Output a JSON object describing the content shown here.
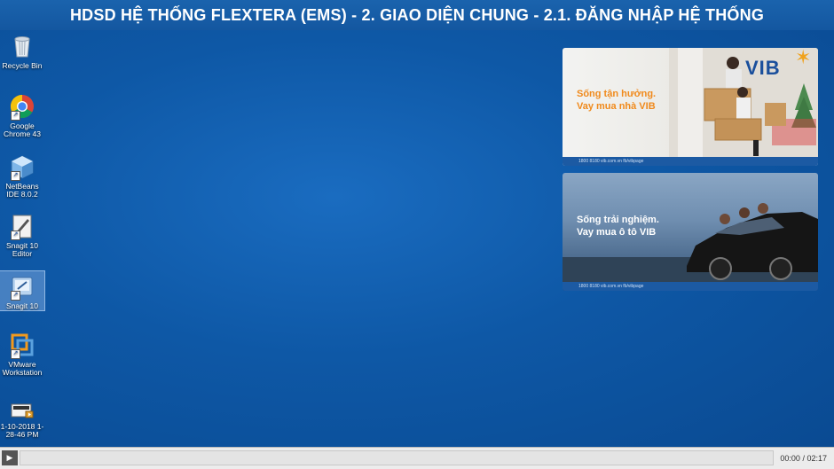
{
  "title": "HDSD HỆ THỐNG FLEXTERA (EMS) - 2. GIAO DIỆN CHUNG - 2.1. ĐĂNG NHẬP HỆ THỐNG",
  "desktop_icons": [
    {
      "name": "recycle-bin-icon",
      "label": "Recycle Bin"
    },
    {
      "name": "chrome-icon",
      "label": "Google Chrome 43"
    },
    {
      "name": "netbeans-icon",
      "label": "NetBeans IDE 8.0.2"
    },
    {
      "name": "snagit-editor-icon",
      "label": "Snagit 10 Editor"
    },
    {
      "name": "snagit-icon",
      "label": "Snagit 10"
    },
    {
      "name": "vmware-icon",
      "label": "VMware Workstation"
    },
    {
      "name": "recording-file-icon",
      "label": "1-10-2018 1-28-46 PM"
    }
  ],
  "ads": [
    {
      "brand": "VIB",
      "slogan_line1": "Sống tận hưởng.",
      "slogan_line2": "Vay mua nhà VIB",
      "footer": "1800 8180   vib.com.vn   fb/vibpage"
    },
    {
      "slogan_line1": "Sống trải nghiệm.",
      "slogan_line2": "Vay mua ô tô VIB",
      "footer": "1800 8180   vib.com.vn   fb/vibpage"
    }
  ],
  "player": {
    "current_time": "00:00",
    "separator": "/",
    "total_time": "02:17",
    "progress": 0
  }
}
